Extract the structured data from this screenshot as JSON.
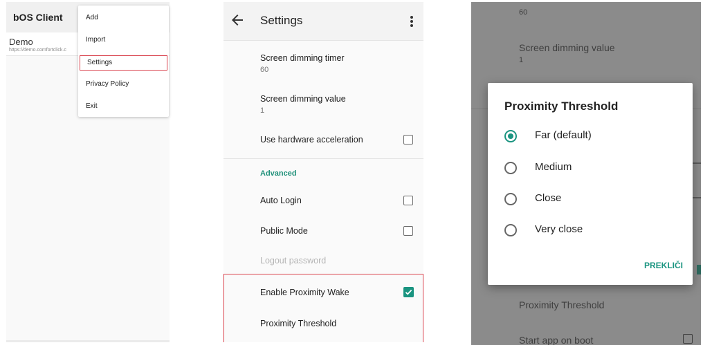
{
  "panel1": {
    "app_title": "bOS Client",
    "connection": {
      "name": "Demo",
      "url": "https://demo.comfortclick.c"
    },
    "menu": [
      "Add",
      "Import",
      "Settings",
      "Privacy Policy",
      "Exit"
    ]
  },
  "panel2": {
    "title": "Settings",
    "items": {
      "dim_timer_title": "Screen dimming timer",
      "dim_timer_value": "60",
      "dim_value_title": "Screen dimming value",
      "dim_value_value": "1",
      "hw_accel": "Use hardware acceleration",
      "section_advanced": "Advanced",
      "auto_login": "Auto Login",
      "public_mode": "Public Mode",
      "logout_password": "Logout password",
      "proximity_wake": "Enable Proximity Wake",
      "proximity_threshold": "Proximity Threshold"
    }
  },
  "panel3": {
    "bg_timer_value": "60",
    "bg_dim_title": "Screen dimming value",
    "bg_dim_value": "1",
    "bg_proximity": "Proximity Threshold",
    "bg_start_boot": "Start app on boot",
    "dialog": {
      "title": "Proximity Threshold",
      "options": [
        "Far (default)",
        "Medium",
        "Close",
        "Very close"
      ],
      "selected_index": 0,
      "cancel": "PREKLIČI"
    }
  },
  "colors": {
    "accent": "#1a9480",
    "highlight": "#d9414c"
  }
}
